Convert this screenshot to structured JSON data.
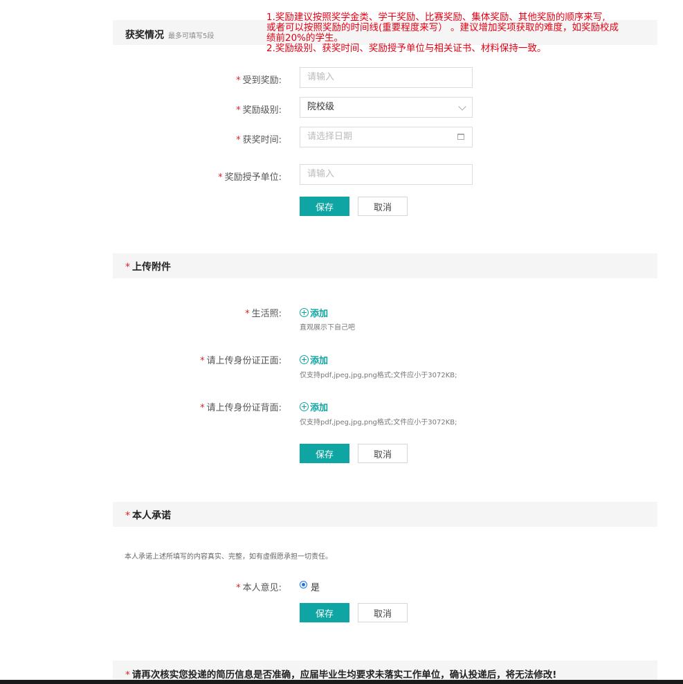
{
  "award": {
    "title": "获奖情况",
    "subtitle": "最多可填写5段",
    "note": [
      "1.奖励建议按照奖学金类、学干奖励、比赛奖励、集体奖励、其他奖励的顺序来写,",
      "或者可以按照奖励的时间线(重要程度来写） 。建议增加奖项获取的难度，如奖励校成",
      "绩前20%的学生。",
      "2.奖励级别、获奖时间、奖励授予单位与相关证书、材料保持一致。"
    ],
    "fields": {
      "name_label": "受到奖励:",
      "name_placeholder": "请输入",
      "level_label": "奖励级别:",
      "level_value": "院校级",
      "time_label": "获奖时间:",
      "time_placeholder": "请选择日期",
      "unit_label": "奖励授予单位:",
      "unit_placeholder": "请输入"
    },
    "save": "保存",
    "cancel": "取消"
  },
  "attach": {
    "title": "上传附件",
    "life_label": "生活照:",
    "life_add": "添加",
    "life_hint": "直观展示下自己吧",
    "id_front_label": "请上传身份证正面:",
    "id_front_add": "添加",
    "id_front_hint": "仅支持pdf,jpeg,jpg,png格式;文件应小于3072KB;",
    "id_back_label": "请上传身份证背面:",
    "id_back_add": "添加",
    "id_back_hint": "仅支持pdf,jpeg,jpg,png格式;文件应小于3072KB;",
    "save": "保存",
    "cancel": "取消"
  },
  "promise": {
    "title": "本人承诺",
    "text": "本人承诺上述所填写的内容真实、完整，如有虚假愿承担一切责任。",
    "opinion_label": "本人意见:",
    "opinion_value": "是",
    "save": "保存",
    "cancel": "取消"
  },
  "confirm": {
    "title": "请再次核实您投递的简历信息是否准确，应届毕业生均要求未落实工作单位，确认投递后，将无法修改!"
  },
  "required_mark": "*",
  "colors": {
    "accent": "#0ea5a2",
    "note_red": "#e60012",
    "required_red": "#e02020"
  }
}
